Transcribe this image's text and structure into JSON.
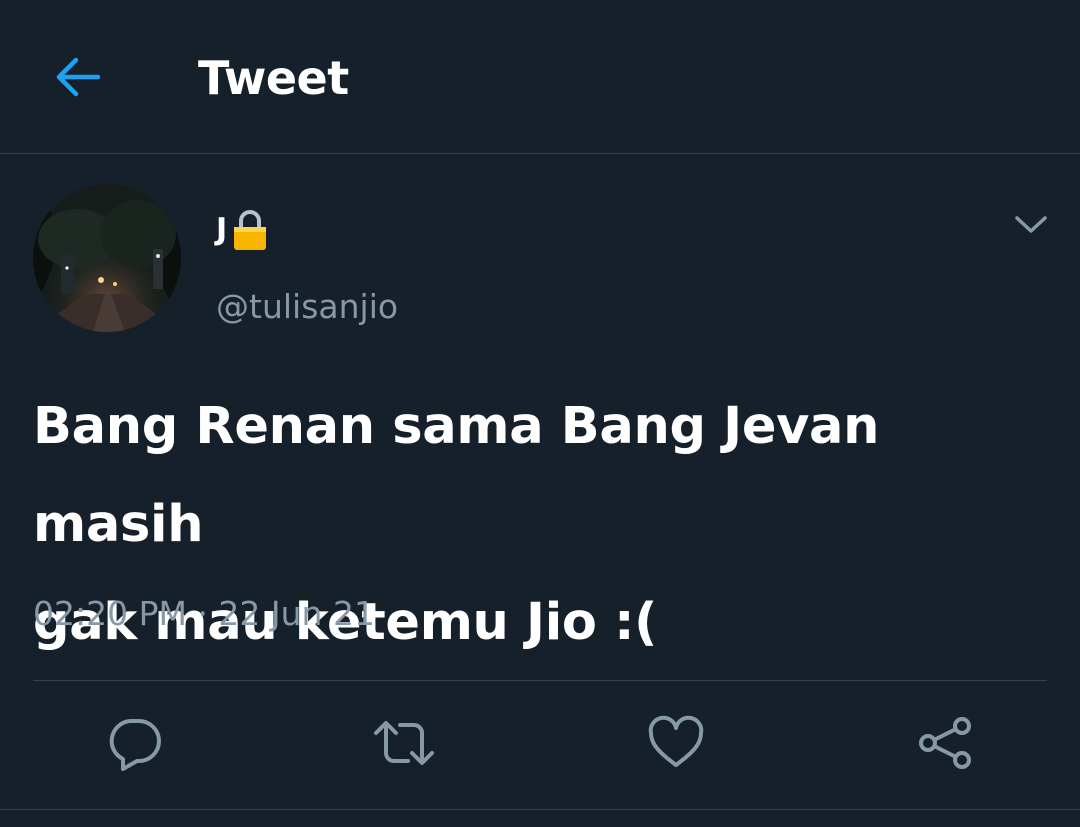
{
  "header": {
    "title": "Tweet",
    "back_icon": "arrow-left-icon"
  },
  "tweet": {
    "author": {
      "display_name": "J",
      "protected_icon": "lock-icon",
      "handle": "@tulisanjio",
      "avatar": "night-street-photo"
    },
    "text_line_1": "Bang Renan sama Bang Jevan masih",
    "text_line_2": "gak mau ketemu Jio :(",
    "timestamp": "02:20 PM · 22 Jun 21"
  },
  "actions": [
    "reply-icon",
    "retweet-icon",
    "like-icon",
    "share-icon"
  ],
  "colors": {
    "background": "#15202b",
    "accent": "#1da1f2",
    "secondary_text": "#8899a6",
    "divider": "#38444d",
    "lock": "#f7b500"
  }
}
